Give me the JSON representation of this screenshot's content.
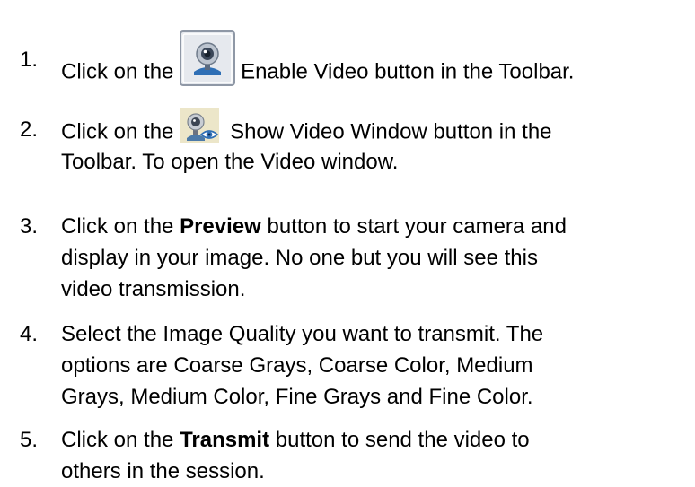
{
  "steps": [
    {
      "number": "1.",
      "lines": [
        {
          "before": "Click on the",
          "icon": "webcam-toolbar-button-icon",
          "after": "Enable Video button in the Toolbar."
        }
      ]
    },
    {
      "number": "2.",
      "lines": [
        {
          "before": "Click on the",
          "icon": "webcam-eye-icon",
          "after": "Show Video Window button in the"
        },
        {
          "text": "Toolbar. To open the Video window."
        }
      ]
    },
    {
      "number": "3.",
      "lines": [
        {
          "pre": "Click on the ",
          "bold": "Preview",
          "post": " button to start your camera and"
        },
        {
          "text": "display in your image. No one but you will see this"
        },
        {
          "text": "video transmission."
        }
      ]
    },
    {
      "number": "4.",
      "lines": [
        {
          "text": "Select the Image Quality you want to transmit. The"
        },
        {
          "text": "options are Coarse Grays, Coarse Color, Medium"
        },
        {
          "text": "Grays, Medium Color, Fine Grays and Fine Color."
        }
      ]
    },
    {
      "number": "5.",
      "lines": [
        {
          "pre": "Click on the ",
          "bold": "Transmit",
          "post": " button to send the video to"
        },
        {
          "text": "others in the session."
        }
      ]
    }
  ],
  "colors": {
    "text": "#000000",
    "icon_blue": "#2f6fb5",
    "icon_button_bg": "#e6e9ee"
  }
}
